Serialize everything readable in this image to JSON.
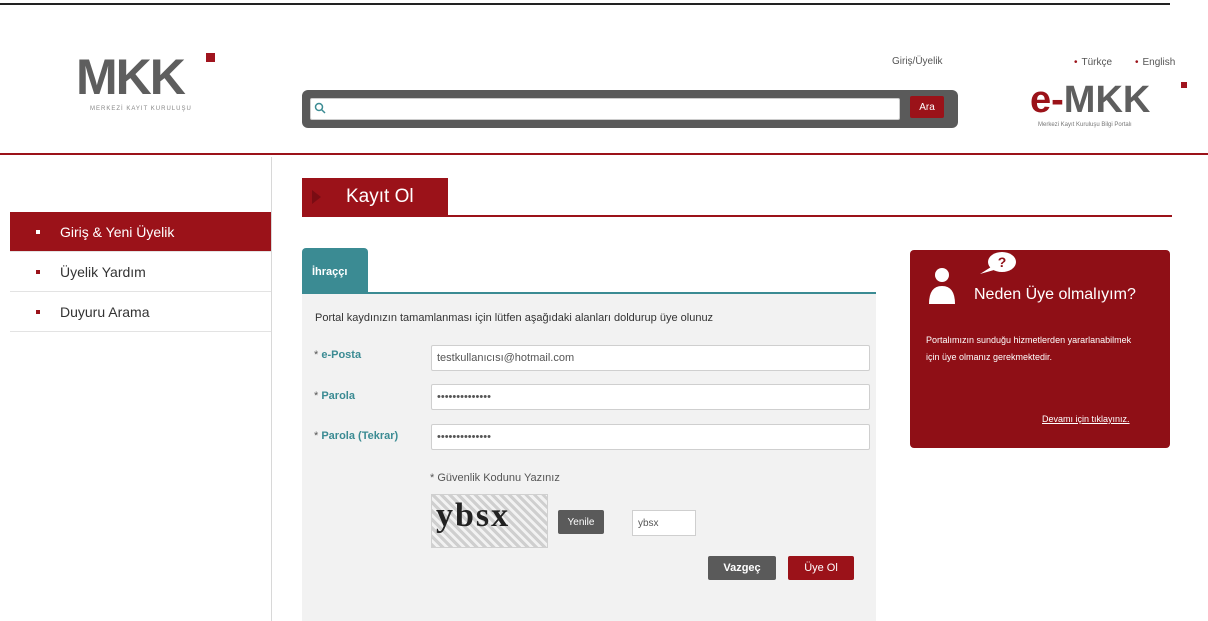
{
  "header": {
    "logo_text": "MKK",
    "logo_sub": "MERKEZİ KAYIT KURULUŞU",
    "search": {
      "placeholder": "",
      "button": "Ara"
    },
    "login_link": "Giriş/Üyelik",
    "languages": [
      "Türkçe",
      "English"
    ],
    "emkk_logo_e": "e-",
    "emkk_logo_mkk": "MKK",
    "emkk_sub": "Merkezi Kayıt Kuruluşu Bilgi Portalı"
  },
  "sidebar": {
    "items": [
      {
        "label": "Giriş & Yeni Üyelik",
        "active": true
      },
      {
        "label": "Üyelik Yardım",
        "active": false
      },
      {
        "label": "Duyuru Arama",
        "active": false
      }
    ]
  },
  "page": {
    "title": "Kayıt Ol"
  },
  "form": {
    "tab": "İhraççı",
    "instructions": "Portal kaydınızın tamamlanması için lütfen aşağıdaki alanları doldurup üye olunuz",
    "fields": [
      {
        "label": "e-Posta",
        "value": "testkullanıcısı@hotmail.com"
      },
      {
        "label": "Parola",
        "value": "••••••••••••••"
      },
      {
        "label": "Parola (Tekrar)",
        "value": "••••••••••••••"
      }
    ],
    "captcha": {
      "label": "* Güvenlik Kodunu Yazınız",
      "image_text": "ybsx",
      "refresh_button": "Yenile",
      "input_value": "ybsx"
    },
    "cancel_button": "Vazgeç",
    "submit_button": "Üye Ol"
  },
  "info": {
    "title": "Neden Üye olmalıyım?",
    "body": "Portalımızın sunduğu hizmetlerden yararlanabilmek için üye olmanız gerekmektedir.",
    "link": "Devamı için tıklayınız."
  },
  "colors": {
    "brand_red": "#9b1219",
    "teal": "#3b8b93",
    "dark_gray": "#5a5a5a"
  }
}
